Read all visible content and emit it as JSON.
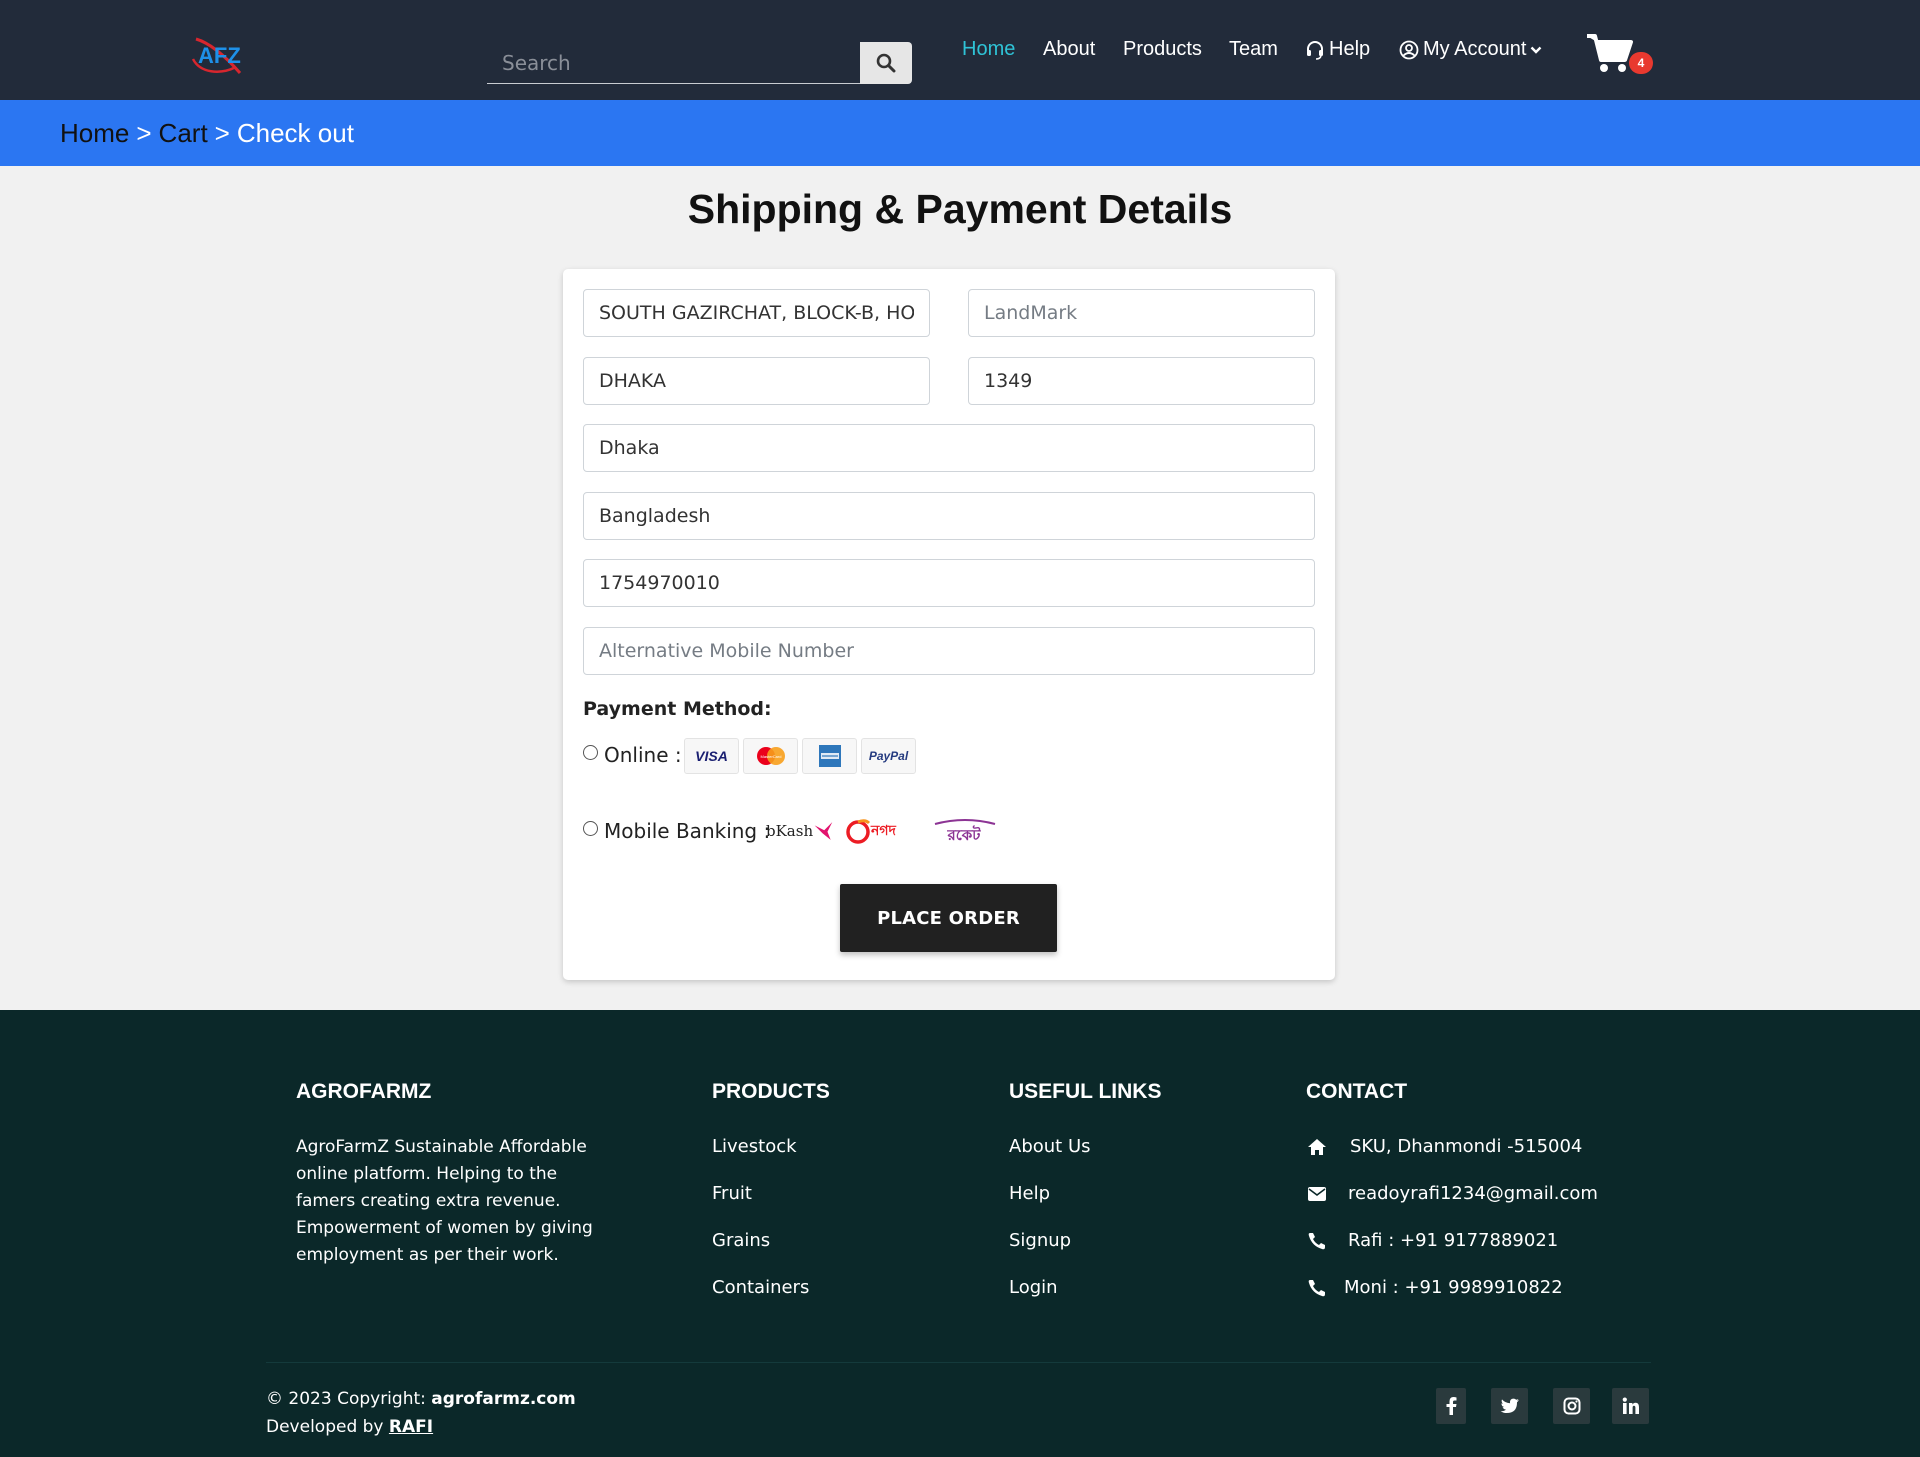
{
  "nav": {
    "logo_text": "AFZ",
    "search_placeholder": "Search",
    "links": {
      "home": "Home",
      "about": "About",
      "products": "Products",
      "team": "Team",
      "help": "Help",
      "account": "My Account"
    },
    "cart_count": "4"
  },
  "breadcrumb": {
    "home": "Home",
    "cart": "Cart",
    "current": "Check out",
    "separator": ">"
  },
  "page_title": "Shipping & Payment Details",
  "form": {
    "address": {
      "value": "SOUTH GAZIRCHAT, BLOCK-B, HOUSE",
      "placeholder": ""
    },
    "landmark": {
      "value": "",
      "placeholder": "LandMark"
    },
    "city": {
      "value": "DHAKA",
      "placeholder": ""
    },
    "postcode": {
      "value": "1349",
      "placeholder": ""
    },
    "state": {
      "value": "Dhaka",
      "placeholder": ""
    },
    "country": {
      "value": "Bangladesh",
      "placeholder": ""
    },
    "mobile": {
      "value": "1754970010",
      "placeholder": ""
    },
    "alt_mobile": {
      "value": "",
      "placeholder": "Alternative Mobile Number"
    },
    "payment_label": "Payment Method:",
    "online_label": "Online :",
    "mobile_banking_label": "Mobile Banking :",
    "cards": {
      "visa": "VISA",
      "mastercard": "MasterCard",
      "paypal": "PayPal"
    },
    "mobile_banking": {
      "bkash": "bKash",
      "nagad": "নগদ",
      "rocket": "রকেট"
    },
    "place_order": "PLACE ORDER"
  },
  "footer": {
    "about": {
      "title": "AGROFARMZ",
      "text": "AgroFarmZ Sustainable Affordable online platform. Helping to the famers creating extra revenue. Empowerment of women by giving employment as per their work."
    },
    "products": {
      "title": "PRODUCTS",
      "items": [
        "Livestock",
        "Fruit",
        "Grains",
        "Containers"
      ]
    },
    "useful": {
      "title": "USEFUL LINKS",
      "items": [
        "About Us",
        "Help",
        "Signup",
        "Login"
      ]
    },
    "contact": {
      "title": "CONTACT",
      "address": "SKU, Dhanmondi -515004",
      "email": "readoyrafi1234@gmail.com",
      "phone1": "Rafi : +91 9177889021",
      "phone2": "Moni : +91 9989910822"
    },
    "copyright_prefix": "© 2023 Copyright:",
    "copyright_site": "agrofarmz.com",
    "developed_prefix": "Developed by",
    "developer": "RAFI"
  },
  "colors": {
    "navbar": "#222b3a",
    "accent_link": "#2fc3d6",
    "breadcrumb_bar": "#2b76f2",
    "footer": "#0b2829",
    "button": "#212121",
    "badge": "#e8392f"
  },
  "icons": [
    "logo",
    "search-icon",
    "headset-icon",
    "user-circle-icon",
    "chevron-down-icon",
    "cart-icon",
    "home-icon",
    "envelope-icon",
    "phone-icon",
    "facebook-icon",
    "twitter-icon",
    "instagram-icon",
    "linkedin-icon"
  ]
}
